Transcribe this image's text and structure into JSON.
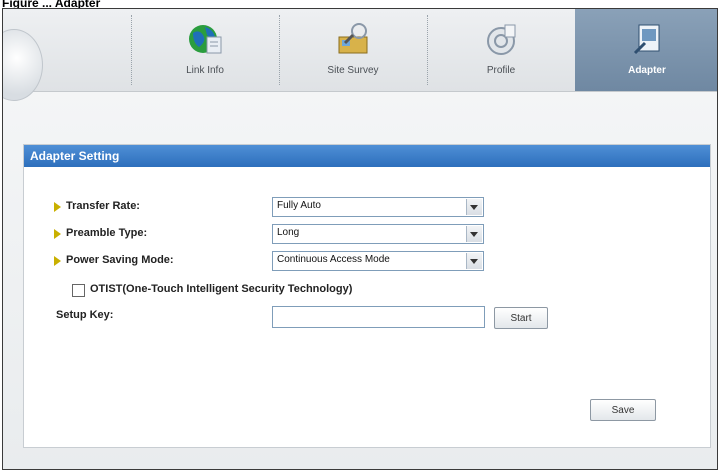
{
  "figure": {
    "caption": "Figure ... Adapter"
  },
  "tabs": [
    {
      "label": "Link Info",
      "icon": "globe-icon"
    },
    {
      "label": "Site Survey",
      "icon": "site-survey-icon"
    },
    {
      "label": "Profile",
      "icon": "profile-icon"
    },
    {
      "label": "Adapter",
      "icon": "adapter-icon",
      "active": true
    }
  ],
  "panel": {
    "title": "Adapter Setting",
    "transfer_rate": {
      "label": "Transfer Rate:",
      "value": "Fully Auto"
    },
    "preamble_type": {
      "label": "Preamble Type:",
      "value": "Long"
    },
    "power_saving": {
      "label": "Power Saving Mode:",
      "value": "Continuous Access Mode"
    },
    "otist": {
      "label": "OTIST(One-Touch Intelligent Security Technology)",
      "checked": false
    },
    "setup_key": {
      "label": "Setup Key:",
      "value": ""
    },
    "start_label": "Start",
    "save_label": "Save"
  }
}
